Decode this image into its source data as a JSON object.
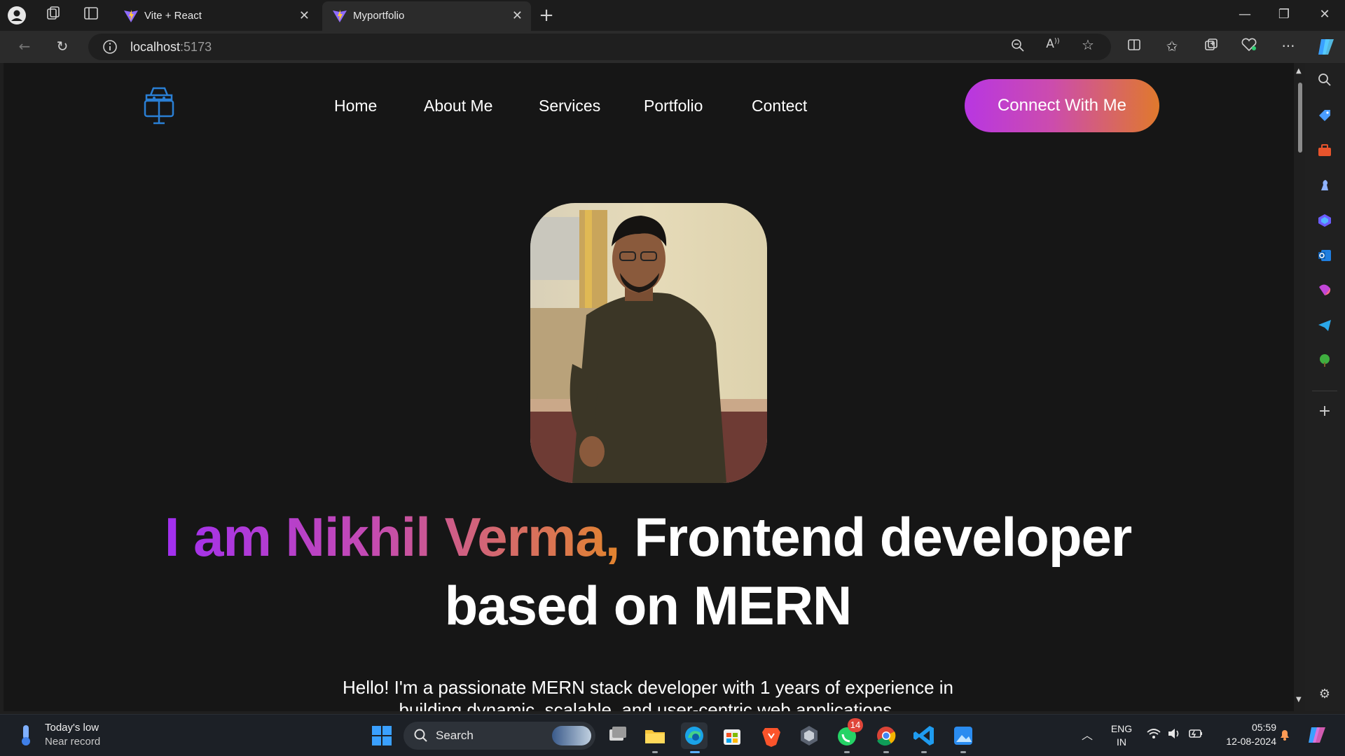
{
  "browser": {
    "tabs": [
      {
        "label": "Vite + React"
      },
      {
        "label": "Myportfolio"
      }
    ],
    "url_host": "localhost",
    "url_port": ":5173"
  },
  "site": {
    "nav": [
      "Home",
      "About Me",
      "Services",
      "Portfolio",
      "Contect"
    ],
    "connect_label": "Connect With Me",
    "headline_highlight": "I am Nikhil Verma,",
    "headline_rest": " Frontend developer based on MERN",
    "intro_line1": "Hello! I'm a passionate MERN stack developer with 1 years of experience in",
    "intro_line2": "building dynamic, scalable, and user-centric web applications."
  },
  "taskbar": {
    "weather_title": "Today's low",
    "weather_sub": "Near record",
    "search_label": "Search",
    "whatsapp_badge": "14",
    "lang_line1": "ENG",
    "lang_line2": "IN",
    "time": "05:59",
    "date": "12-08-2024"
  },
  "colors": {
    "accent_purple": "#a12ff0",
    "accent_orange": "#e2842e",
    "page_bg": "#161616"
  }
}
